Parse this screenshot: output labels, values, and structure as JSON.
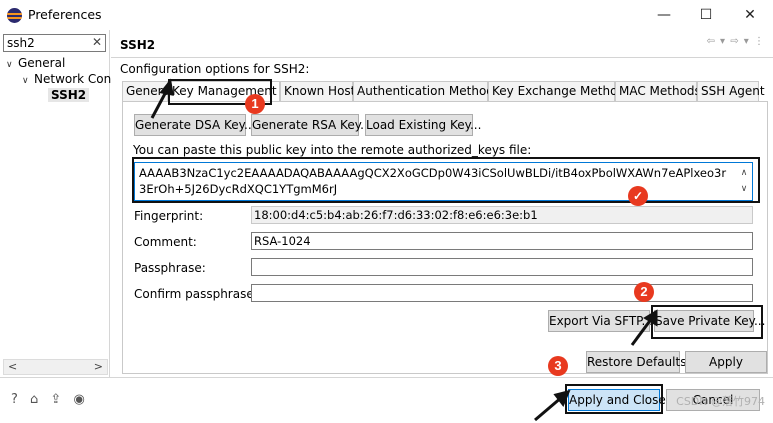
{
  "window": {
    "title": "Preferences",
    "minimize_glyph": "—",
    "maximize_glyph": "☐",
    "close_glyph": "✕"
  },
  "sidebar": {
    "filter_value": "ssh2",
    "filter_clear_glyph": "✕",
    "tree": [
      {
        "label": "General",
        "arrow": "∨"
      },
      {
        "label": "Network Con",
        "arrow": "∨"
      },
      {
        "label": "SSH2",
        "arrow": ""
      }
    ],
    "scroll_left": "<",
    "scroll_right": ">"
  },
  "page": {
    "title": "SSH2",
    "nav_icons": "⇦ ▾ ⇨ ▾ ⋮",
    "description": "Configuration options for SSH2:"
  },
  "tabs": [
    {
      "label": "General"
    },
    {
      "label": "Key Management",
      "active": true
    },
    {
      "label": "Known Hosts"
    },
    {
      "label": "Authentication Methods"
    },
    {
      "label": "Key Exchange Methods"
    },
    {
      "label": "MAC Methods"
    },
    {
      "label": "SSH Agent"
    }
  ],
  "key_management": {
    "generate_dsa": "Generate DSA Key...",
    "generate_rsa": "Generate RSA Key...",
    "load_existing": "Load Existing Key...",
    "paste_label": "You can paste this public key into the remote authorized_keys file:",
    "public_key": "AAAAB3NzaC1yc2EAAAADAQABAAAAgQCX2XoGCDp0W43iCSolUwBLDi/itB4oxPbolWXAWn7eAPlxeo3r3ErOh+5J26DycRdXQC1YTgmM6rJ",
    "key_scroll_up": "∧",
    "key_scroll_down": "∨",
    "fingerprint_label": "Fingerprint:",
    "fingerprint_value": "18:00:d4:c5:b4:ab:26:f7:d6:33:02:f8:e6:e6:3e:b1",
    "comment_label": "Comment:",
    "comment_value": "RSA-1024",
    "passphrase_label": "Passphrase:",
    "passphrase_value": "",
    "confirm_label": "Confirm passphrase:",
    "confirm_value": "",
    "export_sftp": "Export Via SFTP...",
    "save_private": "Save Private Key..."
  },
  "page_buttons": {
    "restore_defaults": "Restore Defaults",
    "apply": "Apply"
  },
  "dialog_buttons": {
    "apply_and_close": "Apply and Close",
    "cancel": "Cancel"
  },
  "bottom_icons": "? ⌂ ⇪ ◉",
  "annotations": {
    "badge_1": "1",
    "badge_2": "2",
    "badge_3": "3",
    "check": "✓",
    "watermark": "CSDN @落竹974"
  },
  "colors": {
    "badge_red": "#e8391f",
    "focus_blue": "#0078d7",
    "button_face": "#e1e1e1"
  }
}
